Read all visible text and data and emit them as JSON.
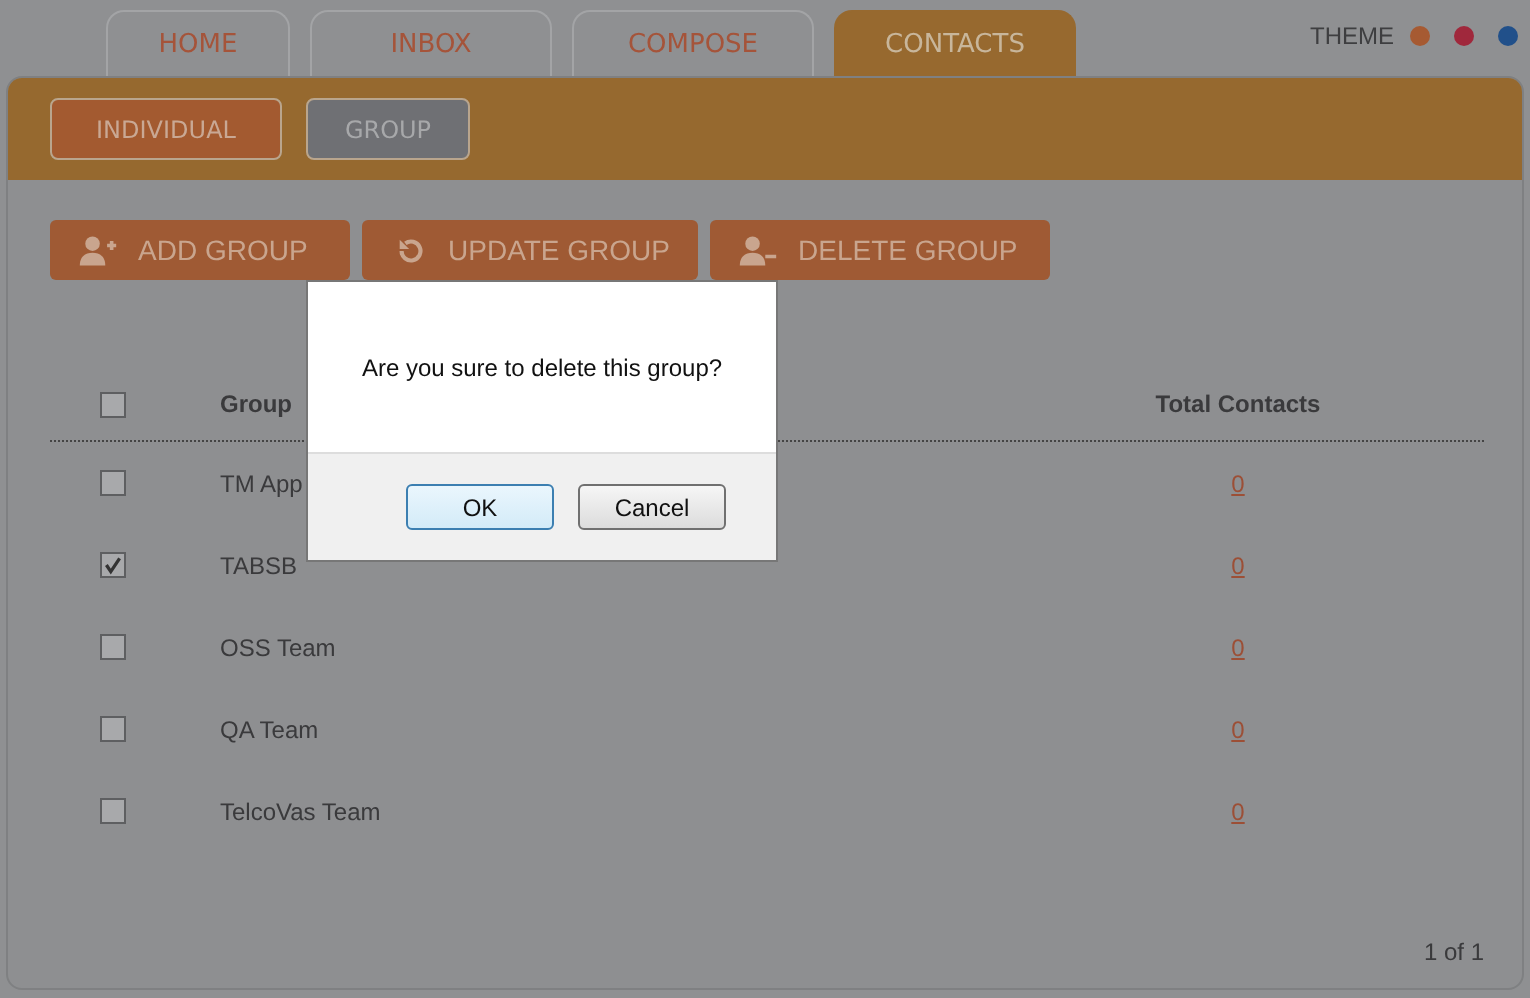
{
  "tabs": [
    {
      "label": "HOME",
      "selected": false
    },
    {
      "label": "INBOX",
      "selected": false
    },
    {
      "label": "COMPOSE",
      "selected": false
    },
    {
      "label": "CONTACTS",
      "selected": true
    }
  ],
  "theme": {
    "label": "THEME",
    "swatches": [
      {
        "color": "#a65a32"
      },
      {
        "color": "#a0283c"
      },
      {
        "color": "#21508a"
      }
    ]
  },
  "sub_tabs": [
    {
      "label": "INDIVIDUAL",
      "selected": false
    },
    {
      "label": "GROUP",
      "selected": true
    }
  ],
  "actions": [
    {
      "kind": "add",
      "label": "ADD GROUP"
    },
    {
      "kind": "update",
      "label": "UPDATE GROUP"
    },
    {
      "kind": "delete",
      "label": "DELETE GROUP"
    }
  ],
  "table": {
    "header": {
      "checked": false,
      "columns": [
        "Group",
        "Total Contacts"
      ]
    },
    "rows": [
      {
        "checked": false,
        "name": "TM App",
        "total": "0"
      },
      {
        "checked": true,
        "name": "TABSB",
        "total": "0"
      },
      {
        "checked": false,
        "name": "OSS Team",
        "total": "0"
      },
      {
        "checked": false,
        "name": "QA Team",
        "total": "0"
      },
      {
        "checked": false,
        "name": "TelcoVas Team",
        "total": "0"
      }
    ]
  },
  "pagination": "1 of 1",
  "dialog": {
    "message": "Are you sure to delete this group?",
    "buttons": [
      {
        "label": "OK",
        "selected": true
      },
      {
        "label": "Cancel",
        "selected": false
      }
    ]
  }
}
